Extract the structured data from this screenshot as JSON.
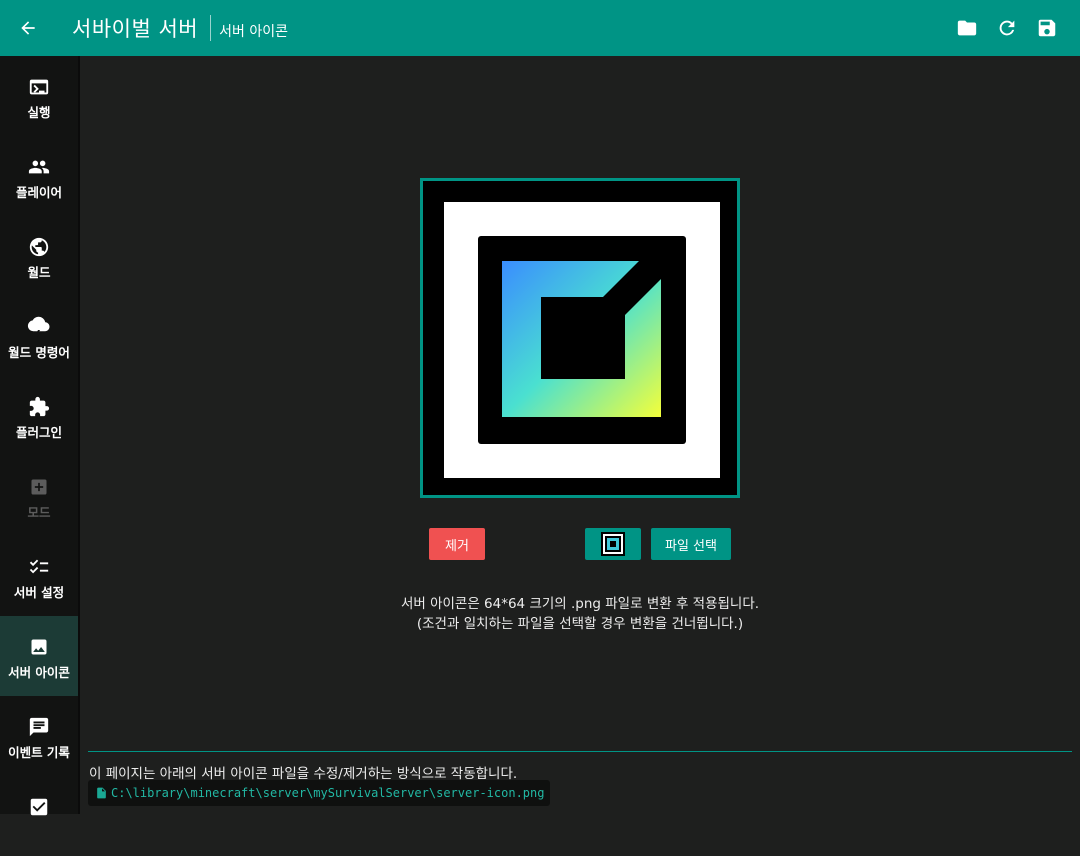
{
  "header": {
    "title": "서바이벌 서버",
    "subtitle": "서버 아이콘",
    "actions": [
      "folder-icon",
      "refresh-icon",
      "save-icon"
    ]
  },
  "sidebar": {
    "items": [
      {
        "label": "실행",
        "icon": "terminal-icon",
        "state": "normal"
      },
      {
        "label": "플레이어",
        "icon": "people-icon",
        "state": "normal"
      },
      {
        "label": "월드",
        "icon": "globe-icon",
        "state": "normal"
      },
      {
        "label": "월드 명령어",
        "icon": "storm-cloud-icon",
        "state": "normal"
      },
      {
        "label": "플러그인",
        "icon": "puzzle-icon",
        "state": "normal"
      },
      {
        "label": "모드",
        "icon": "plus-box-icon",
        "state": "disabled"
      },
      {
        "label": "서버 설정",
        "icon": "checklist-icon",
        "state": "normal"
      },
      {
        "label": "서버 아이콘",
        "icon": "image-icon",
        "state": "active"
      },
      {
        "label": "이벤트 기록",
        "icon": "chat-icon",
        "state": "normal"
      },
      {
        "label": "",
        "icon": "checkbox-icon",
        "state": "normal"
      }
    ]
  },
  "main": {
    "remove_label": "제거",
    "choose_label": "파일 선택",
    "info_line1": "서버 아이콘은 64*64 크기의 .png 파일로 변환 후 적용됩니다.",
    "info_line2": "(조건과 일치하는 파일을 선택할 경우 변환을 건너뜁니다.)",
    "footer_note": "이 페이지는 아래의 서버 아이콘 파일을 수정/제거하는 방식으로 작동합니다.",
    "file_path": "C:\\library\\minecraft\\server\\mySurvivalServer\\server-icon.png"
  },
  "colors": {
    "accent": "#009485",
    "danger": "#f05151",
    "background": "#1e1f1e",
    "sidebar": "#121312"
  }
}
